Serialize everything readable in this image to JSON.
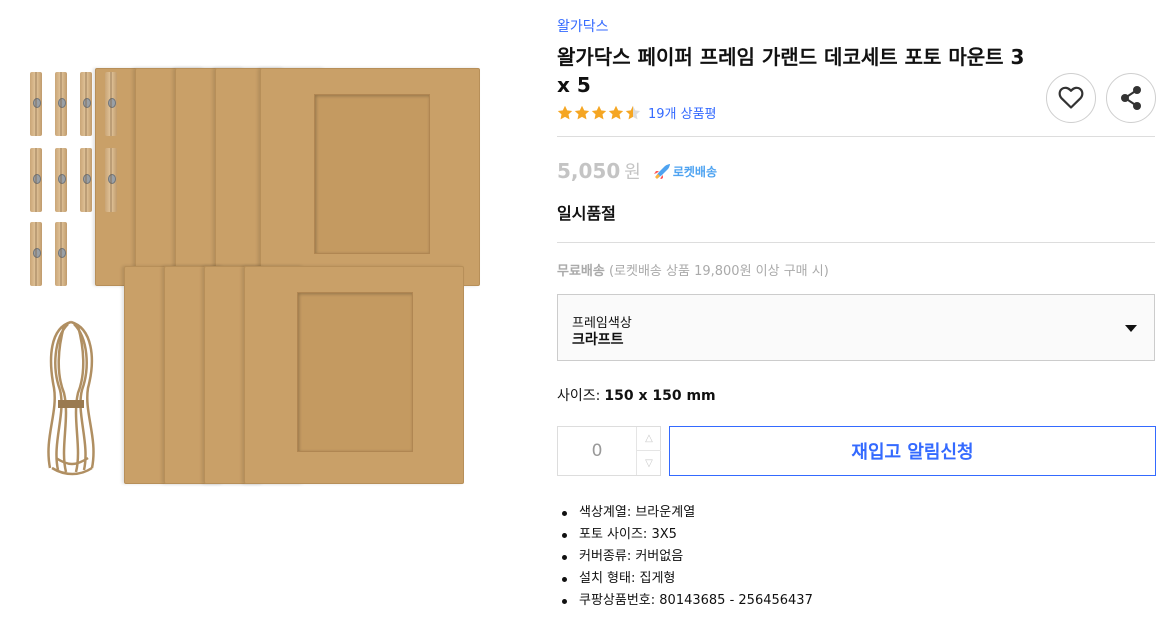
{
  "product": {
    "brand": "왈가닥스",
    "title": "왈가닥스 페이퍼 프레임 가랜드 데코세트 포토 마운트 3 x 5",
    "rating": 4.5,
    "review_count": "19개 상품평",
    "price": "5,050",
    "currency": "원",
    "rocket_label": "로켓배송",
    "stock_status": "일시품절",
    "shipping_label": "무료배송",
    "shipping_note": "(로켓배송 상품 19,800원 이상 구매 시)"
  },
  "option": {
    "label": "프레임색상",
    "value": "크라프트"
  },
  "size": {
    "label": "사이즈:",
    "value": "150 x 150 mm"
  },
  "quantity": {
    "value": "0"
  },
  "buttons": {
    "restock": "재입고 알림신청",
    "wishlist_icon": "heart-icon",
    "share_icon": "share-icon"
  },
  "attributes": [
    "색상계열: 브라운계열",
    "포토 사이즈: 3X5",
    "커버종류: 커버없음",
    "설치 형태: 집게형",
    "쿠팡상품번호: 80143685 - 256456437"
  ],
  "colors": {
    "accent": "#346aff",
    "star": "#f5a623",
    "rocket": "#4ea3f1",
    "kraft": "#c9a068"
  }
}
